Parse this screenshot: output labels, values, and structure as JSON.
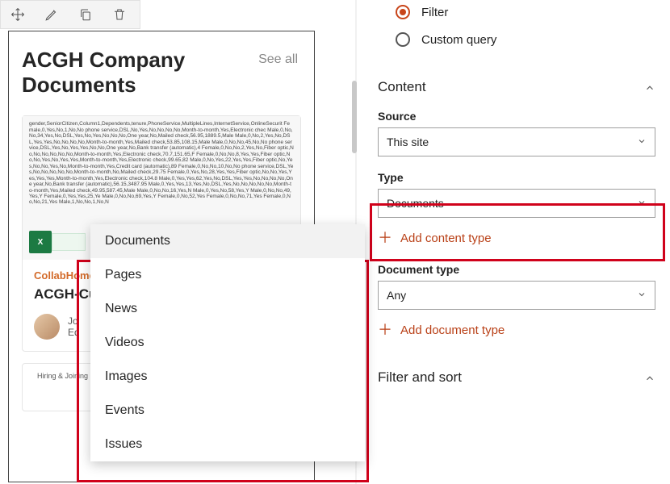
{
  "toolbar": {
    "move": "Move",
    "edit": "Edit",
    "copy": "Duplicate",
    "delete": "Delete"
  },
  "webpart": {
    "title": "ACGH Company Documents",
    "see_all": "See all",
    "card": {
      "thumb_text": "gender,SeniorCitizen,Column1,Dependents,tenure,PhoneService,MultipleLines,InternetService,OnlineSecurit Female,0,Yes,No,1,No,No phone service,DSL,No,Yes,No,No,No,No,Month-to-month,Yes,Electronic chec Male,0,No,No,34,Yes,No,DSL,Yes,No,Yes,No,No,No,One year,No,Mailed check,56.95,1889.5,Male Male,0,No,2,Yes,No,DSL,Yes,Yes,No,No,No,No,Month-to-month,Yes,Mailed check,53.85,108.15,Male Male,0,No,No,45,No,No phone service,DSL,Yes,No,Yes,Yes,No,No,One year,No,Bank transfer (automatic),4 Female,0,No,No,2,Yes,No,Fiber optic,No,No,No,No,No,No,Month-to-month,Yes,Electronic check,70.7,151.65,F Female,0,No,No,8,Yes,Yes,Fiber optic,No,No,Yes,No,Yes,Yes,Month-to-month,Yes,Electronic check,99.65,82 Male,0,No,Yes,22,Yes,Yes,Fiber optic,No,Yes,No,No,Yes,No,Month-to-month,Yes,Credit card (automatic),89 Female,0,No,No,10,No,No phone service,DSL,Yes,No,No,No,No,No,Month-to-month,No,Mailed check,29.75 Female,0,Yes,No,28,Yes,Yes,Fiber optic,No,No,Yes,Yes,Yes,Yes,Month-to-month,Yes,Electronic check,104.8 Male,0,Yes,Yes,62,Yes,No,DSL,Yes,Yes,No,No,No,No,One year,No,Bank transfer (automatic),56.15,3487.95 Male,0,Yes,Yes,13,Yes,No,DSL,Yes,No,No,No,No,No,Month-to-month,Yes,Mailed check,49.95,587.45,Male Male,0,No,No,16,Yes,N Male,0,Yes,No,58,Yes,Y Male,0,No,No,49,Yes,Y Female,0,Yes,Yes,25,Ye Male,0,No,No,69,Yes,Y Female,0,No,52,Yes Female,0,No,No,71,Yes Female,0,No,No,21,Yes Male,1,No,No,1,No,N",
      "breadcrumb": "CollabHome",
      "name": "ACGH-Cu",
      "author_name": "Jo",
      "author_line2": "Ed"
    },
    "partial_text": "Hiring & Joining"
  },
  "type_menu": {
    "items": [
      "Documents",
      "Pages",
      "News",
      "Videos",
      "Images",
      "Events",
      "Issues"
    ],
    "selected_index": 0
  },
  "panel": {
    "radio_filter": "Filter",
    "radio_custom": "Custom query",
    "content_head": "Content",
    "source_label": "Source",
    "source_value": "This site",
    "type_label": "Type",
    "type_value": "Documents",
    "add_content_type": "Add content type",
    "doctype_label": "Document type",
    "doctype_value": "Any",
    "add_doc_type": "Add document type",
    "filter_sort_head": "Filter and sort"
  }
}
